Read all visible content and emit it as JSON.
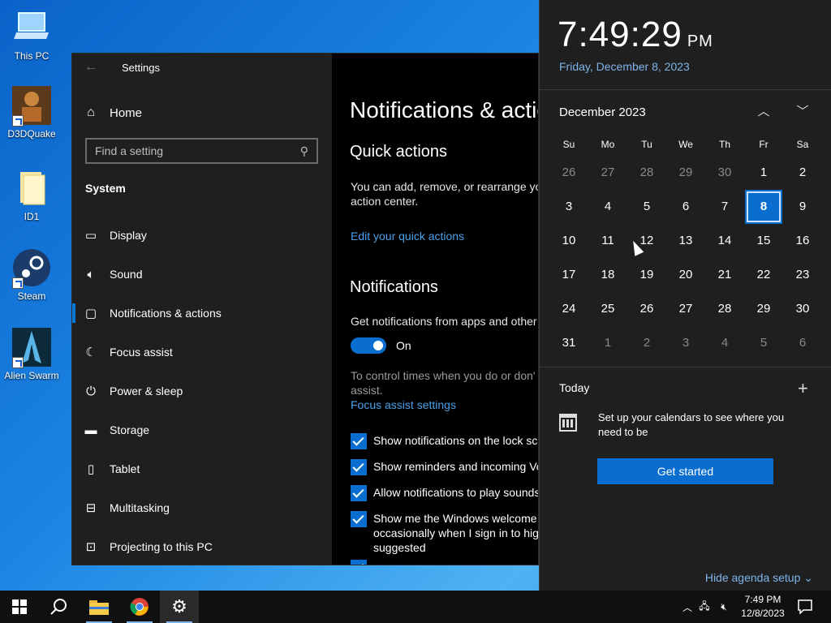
{
  "desktop": {
    "icons": [
      {
        "label": "This PC"
      },
      {
        "label": "D3DQuake"
      },
      {
        "label": "ID1"
      },
      {
        "label": "Steam"
      },
      {
        "label": "Alien Swarm"
      }
    ]
  },
  "settings": {
    "title": "Settings",
    "home": "Home",
    "search_placeholder": "Find a setting",
    "section": "System",
    "nav": [
      {
        "label": "Display",
        "icon": "monitor-icon"
      },
      {
        "label": "Sound",
        "icon": "speaker-icon"
      },
      {
        "label": "Notifications & actions",
        "icon": "notification-icon"
      },
      {
        "label": "Focus assist",
        "icon": "moon-icon"
      },
      {
        "label": "Power & sleep",
        "icon": "power-icon"
      },
      {
        "label": "Storage",
        "icon": "storage-icon"
      },
      {
        "label": "Tablet",
        "icon": "tablet-icon"
      },
      {
        "label": "Multitasking",
        "icon": "multitasking-icon"
      },
      {
        "label": "Projecting to this PC",
        "icon": "projector-icon"
      }
    ],
    "content": {
      "title": "Notifications & actio",
      "quick_actions": "Quick actions",
      "quick_desc": "You can add, remove, or rearrange yo action center.",
      "edit_link": "Edit your quick actions",
      "notifications": "Notifications",
      "get_notifs": "Get notifications from apps and other",
      "toggle_state": "On",
      "focus_desc": "To control times when you do or don' assist.",
      "focus_link": "Focus assist settings",
      "checks": [
        "Show notifications on the lock sc",
        "Show reminders and incoming Vo",
        "Allow notifications to play sounds",
        "Show me the Windows welcome occasionally when I sign in to hig suggested"
      ]
    }
  },
  "flyout": {
    "time": "7:49:29",
    "ampm": "PM",
    "date": "Friday, December 8, 2023",
    "month": "December 2023",
    "dow": [
      "Su",
      "Mo",
      "Tu",
      "We",
      "Th",
      "Fr",
      "Sa"
    ],
    "weeks": [
      [
        "26",
        "27",
        "28",
        "29",
        "30",
        "1",
        "2"
      ],
      [
        "3",
        "4",
        "5",
        "6",
        "7",
        "8",
        "9"
      ],
      [
        "10",
        "11",
        "12",
        "13",
        "14",
        "15",
        "16"
      ],
      [
        "17",
        "18",
        "19",
        "20",
        "21",
        "22",
        "23"
      ],
      [
        "24",
        "25",
        "26",
        "27",
        "28",
        "29",
        "30"
      ],
      [
        "31",
        "1",
        "2",
        "3",
        "4",
        "5",
        "6"
      ]
    ],
    "today_label": "Today",
    "agenda_text": "Set up your calendars to see where you need to be",
    "get_started": "Get started",
    "hide_agenda": "Hide agenda setup"
  },
  "taskbar": {
    "time": "7:49 PM",
    "date": "12/8/2023"
  },
  "colors": {
    "accent": "#0a6ed1",
    "link": "#4ca0e8"
  }
}
